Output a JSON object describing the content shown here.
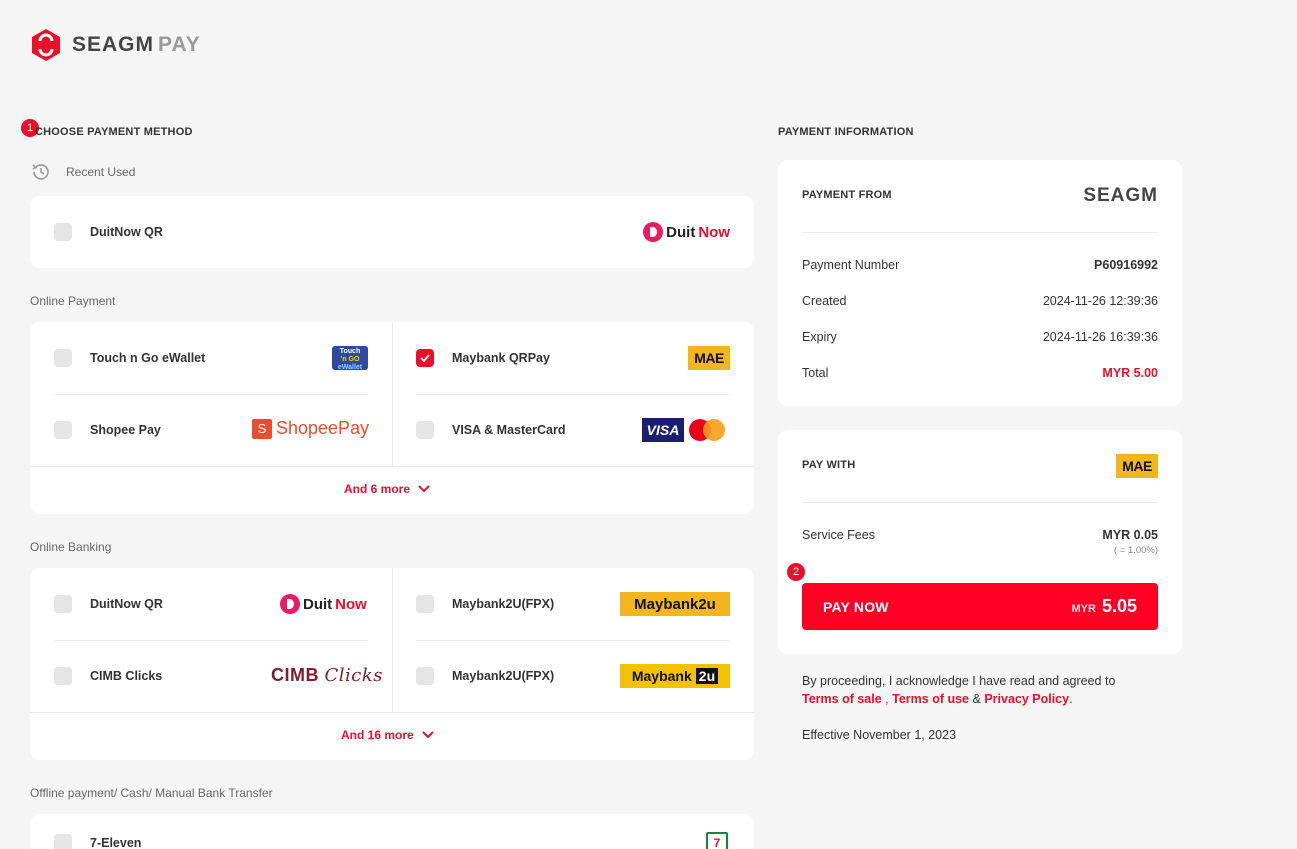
{
  "brand": {
    "name": "SEAGM",
    "suffix": "PAY",
    "accent": "#e8102a"
  },
  "choose": {
    "badge": "1",
    "title": "CHOOSE PAYMENT METHOD",
    "recent_label": "Recent Used"
  },
  "recent": {
    "label": "DuitNow QR",
    "logo_a": "Duit",
    "logo_b": "Now"
  },
  "online_payment": {
    "title": "Online Payment",
    "items": [
      {
        "label": "Touch n Go eWallet",
        "logo_top": "Touch",
        "logo_mid": "'n GO",
        "logo_bot": "eWallet",
        "checked": false
      },
      {
        "label": "Maybank QRPay",
        "logo": "MAE",
        "checked": true
      },
      {
        "label": "Shopee Pay",
        "logo": "ShopeePay",
        "logo_icon": "S",
        "checked": false
      },
      {
        "label": "VISA & MasterCard",
        "logo": "VISA",
        "checked": false
      }
    ],
    "more": "And 6 more"
  },
  "online_banking": {
    "title": "Online Banking",
    "items": [
      {
        "label": "DuitNow QR",
        "logo_a": "Duit",
        "logo_b": "Now"
      },
      {
        "label": "Maybank2U(FPX)",
        "logo": "Maybank2u"
      },
      {
        "label": "CIMB Clicks",
        "logo_a": "CIMB",
        "logo_b": "Clicks"
      },
      {
        "label": "Maybank2U(FPX)",
        "logo_a": "Maybank",
        "logo_b": "2u"
      }
    ],
    "more": "And 16 more"
  },
  "offline": {
    "title": "Offline payment/ Cash/ Manual Bank Transfer",
    "items": [
      {
        "label": "7-Eleven",
        "logo": "7"
      }
    ]
  },
  "payment_info": {
    "title": "PAYMENT INFORMATION",
    "from_label": "PAYMENT FROM",
    "from_logo": "SEAGM",
    "rows": [
      {
        "label": "Payment Number",
        "value": "P60916992"
      },
      {
        "label": "Created",
        "value": "2024-11-26 12:39:36"
      },
      {
        "label": "Expiry",
        "value": "2024-11-26 16:39:36"
      },
      {
        "label": "Total",
        "value": "MYR 5.00"
      }
    ]
  },
  "pay_with": {
    "title": "PAY WITH",
    "logo": "MAE",
    "fees_label": "Service Fees",
    "fees_value": "MYR 0.05",
    "fees_pct": "( = 1.00%)",
    "badge": "2",
    "button_label": "PAY NOW",
    "button_currency": "MYR",
    "button_amount": "5.05"
  },
  "legal": {
    "text": "By proceeding, I acknowledge I have read and agreed to",
    "terms_sale": "Terms of sale",
    "sep1": ",",
    "terms_use": "Terms of use",
    "amp": "&",
    "privacy": "Privacy Policy",
    "end": ".",
    "effective": "Effective November 1, 2023"
  }
}
